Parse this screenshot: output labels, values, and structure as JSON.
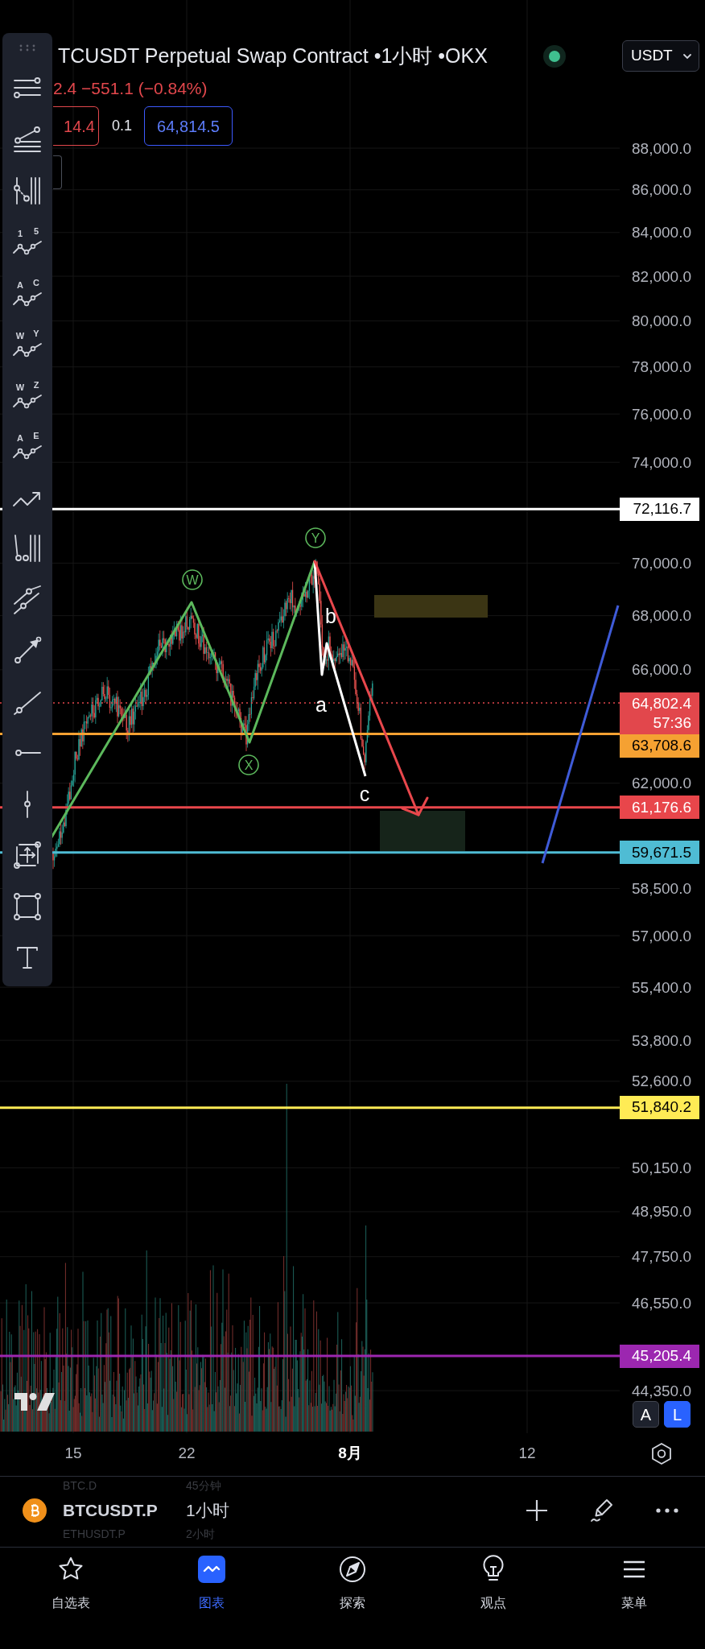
{
  "legend": {
    "title": "TCUSDT Perpetual Swap Contract •1小时 •OKX",
    "change": "2.4 −551.1 (−0.84%)",
    "sell": "14.4",
    "spread": "0.1",
    "buy": "64,814.5"
  },
  "currency": "USDT",
  "drawing_toolbar": {
    "wave_tools": [
      [
        "1",
        "5"
      ],
      [
        "A",
        "C"
      ],
      [
        "W",
        "Y"
      ],
      [
        "W",
        "Z"
      ],
      [
        "A",
        "E"
      ]
    ]
  },
  "price_axis": {
    "ticks": [
      "88,000.0",
      "86,000.0",
      "84,000.0",
      "82,000.0",
      "80,000.0",
      "78,000.0",
      "76,000.0",
      "74,000.0",
      "70,000.0",
      "68,000.0",
      "66,000.0",
      "62,000.0",
      "58,500.0",
      "57,000.0",
      "55,400.0",
      "53,800.0",
      "52,600.0",
      "50,150.0",
      "48,950.0",
      "47,750.0",
      "46,550.0",
      "44,350.0"
    ]
  },
  "price_lines": [
    {
      "kind": "line",
      "price": "72,116.7",
      "color": "#ffffff"
    },
    {
      "kind": "last",
      "price": "64,802.4",
      "countdown": "57:36",
      "color": "#e2474c"
    },
    {
      "kind": "line",
      "price": "63,708.6",
      "color": "#f5a132"
    },
    {
      "kind": "line",
      "price": "61,176.6",
      "color": "#e8464b"
    },
    {
      "kind": "line",
      "price": "59,671.5",
      "color": "#4fbcd4"
    },
    {
      "kind": "line",
      "price": "51,840.2",
      "color": "#ffeb55"
    },
    {
      "kind": "line",
      "price": "45,205.4",
      "color": "#9c27b0"
    }
  ],
  "wave_labels": [
    {
      "text": "W",
      "kind": "circled"
    },
    {
      "text": "X",
      "kind": "circled"
    },
    {
      "text": "Y",
      "kind": "circled"
    },
    {
      "text": "b",
      "kind": "plain"
    },
    {
      "text": "a",
      "kind": "plain"
    },
    {
      "text": "c",
      "kind": "plain"
    }
  ],
  "scale_buttons": [
    {
      "label": "A",
      "selected": false
    },
    {
      "label": "L",
      "selected": true
    }
  ],
  "time_axis": [
    {
      "label": "15",
      "kind": "day"
    },
    {
      "label": "22",
      "kind": "day"
    },
    {
      "label": "8月",
      "kind": "month"
    },
    {
      "label": "12",
      "kind": "day"
    }
  ],
  "symbol_picker": [
    {
      "symbol": "BTC.D",
      "interval": "45分钟",
      "selected": false
    },
    {
      "symbol": "BTCUSDT.P",
      "interval": "1小时",
      "selected": true
    },
    {
      "symbol": "ETHUSDT.P",
      "interval": "2小时",
      "selected": false
    }
  ],
  "bottom_nav": [
    {
      "label": "自选表",
      "selected": false
    },
    {
      "label": "图表",
      "selected": true
    },
    {
      "label": "探索",
      "selected": false
    },
    {
      "label": "观点",
      "selected": false
    },
    {
      "label": "菜单",
      "selected": false
    }
  ]
}
